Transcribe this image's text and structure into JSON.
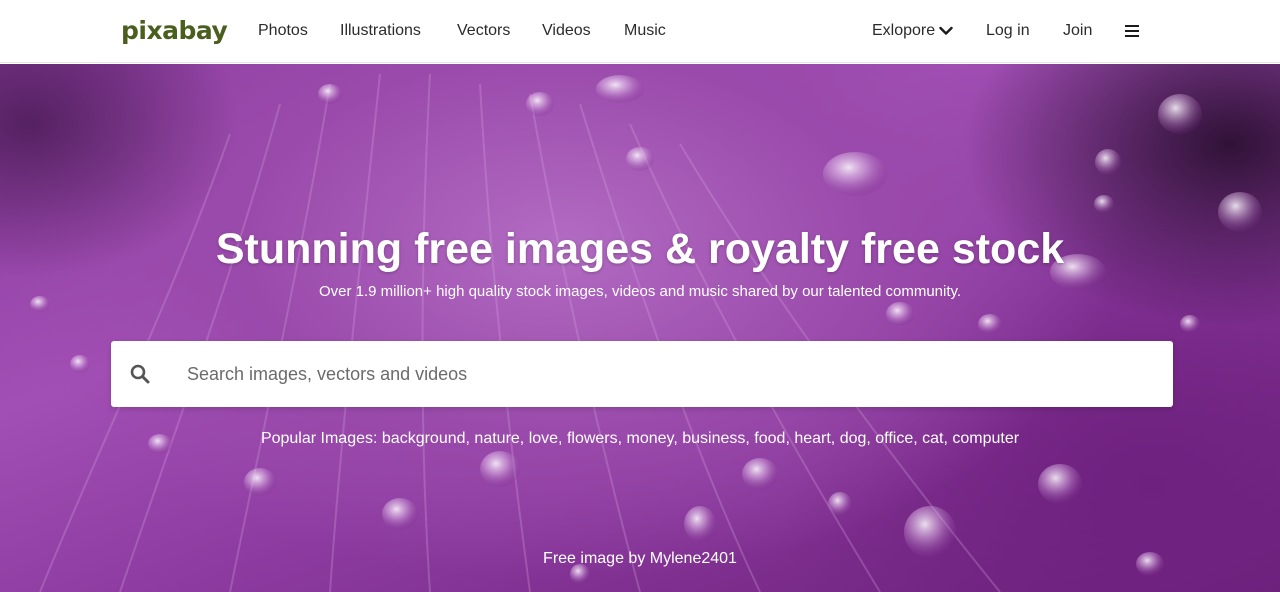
{
  "header": {
    "logo": "pixabay",
    "nav": [
      "Photos",
      "Illustrations",
      "Vectors",
      "Videos",
      "Music"
    ],
    "explore_label": "Exlopore",
    "login_label": "Log in",
    "join_label": "Join",
    "menu_icon": "hamburger-menu-icon"
  },
  "hero": {
    "title": "Stunning free images & royalty free stock",
    "subtitle": "Over 1.9 million+ high quality stock images, videos and music shared by our talented community.",
    "search": {
      "placeholder": "Search images, vectors and videos",
      "value": "",
      "icon": "search-icon"
    },
    "popular": {
      "prefix": "Popular Images:",
      "tags": [
        "background",
        "nature",
        "love",
        "flowers",
        "money",
        "business",
        "food",
        "heart",
        "dog",
        "office",
        "cat",
        "computer"
      ]
    },
    "credit": {
      "prefix": "Free image by",
      "author": "Mylene2401"
    }
  },
  "colors": {
    "logo": "#4a5e1e",
    "hero_purple": "#9a4aab",
    "text_dark": "#2b2b2b"
  }
}
